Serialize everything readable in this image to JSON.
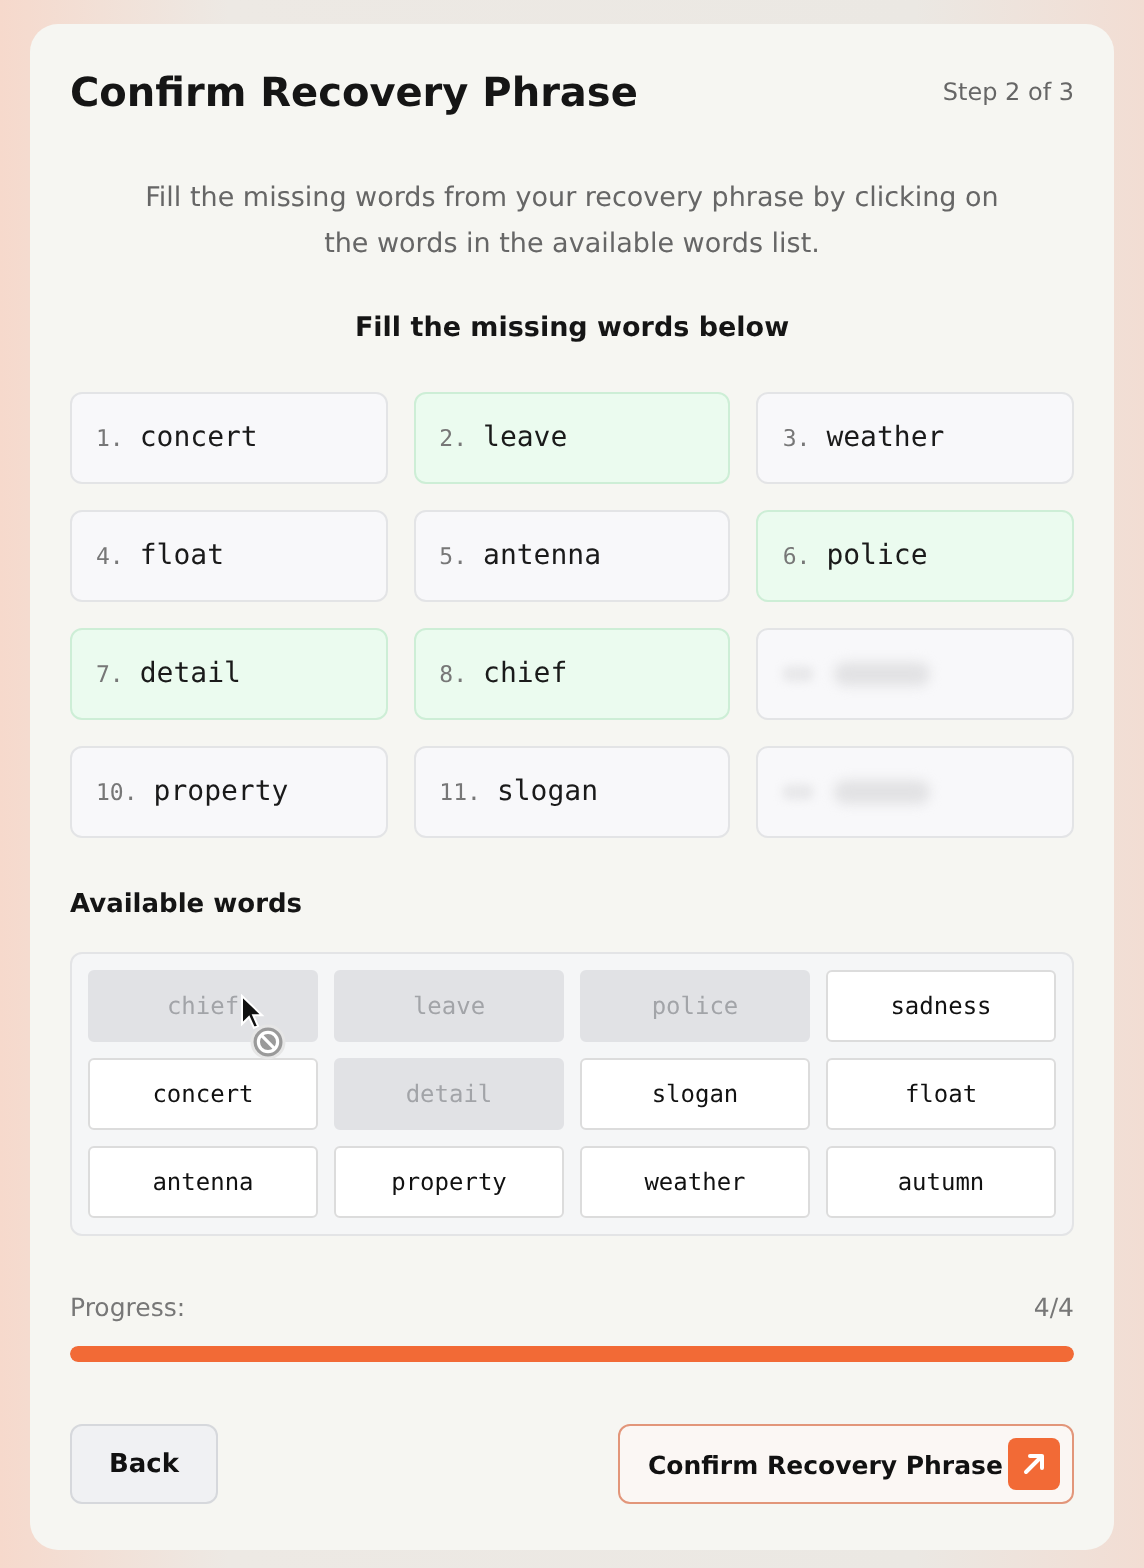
{
  "header": {
    "title": "Confirm Recovery Phrase",
    "step": "Step 2 of 3"
  },
  "instructions": "Fill the missing words from your recovery phrase by clicking on the words in the available words list.",
  "slots_heading": "Fill the missing words below",
  "slots": [
    {
      "kind": "word",
      "number": "1.",
      "word": "concert",
      "filled": false
    },
    {
      "kind": "word",
      "number": "2.",
      "word": "leave",
      "filled": true
    },
    {
      "kind": "word",
      "number": "3.",
      "word": "weather",
      "filled": false
    },
    {
      "kind": "word",
      "number": "4.",
      "word": "float",
      "filled": false
    },
    {
      "kind": "word",
      "number": "5.",
      "word": "antenna",
      "filled": false
    },
    {
      "kind": "word",
      "number": "6.",
      "word": "police",
      "filled": true
    },
    {
      "kind": "word",
      "number": "7.",
      "word": "detail",
      "filled": true
    },
    {
      "kind": "word",
      "number": "8.",
      "word": "chief",
      "filled": true
    },
    {
      "kind": "blurred"
    },
    {
      "kind": "word",
      "number": "10.",
      "word": "property",
      "filled": false
    },
    {
      "kind": "word",
      "number": "11.",
      "word": "slogan",
      "filled": false
    },
    {
      "kind": "blurred"
    }
  ],
  "available_heading": "Available words",
  "available_words": [
    {
      "word": "chief",
      "disabled": true
    },
    {
      "word": "leave",
      "disabled": true
    },
    {
      "word": "police",
      "disabled": true
    },
    {
      "word": "sadness",
      "disabled": false
    },
    {
      "word": "concert",
      "disabled": false
    },
    {
      "word": "detail",
      "disabled": true
    },
    {
      "word": "slogan",
      "disabled": false
    },
    {
      "word": "float",
      "disabled": false
    },
    {
      "word": "antenna",
      "disabled": false
    },
    {
      "word": "property",
      "disabled": false
    },
    {
      "word": "weather",
      "disabled": false
    },
    {
      "word": "autumn",
      "disabled": false
    }
  ],
  "progress": {
    "label": "Progress:",
    "count": "4/4",
    "level": 1
  },
  "buttons": {
    "back": "Back",
    "confirm": "Confirm Recovery Phrase"
  }
}
